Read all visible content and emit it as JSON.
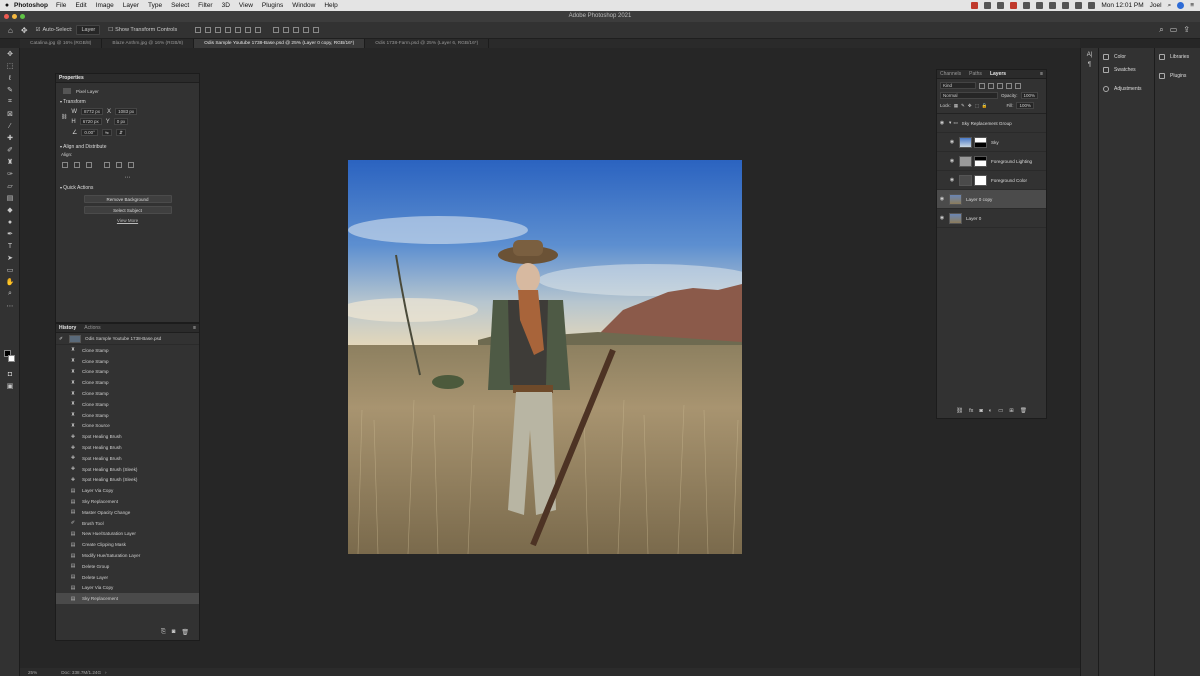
{
  "menubar": {
    "app": "Photoshop",
    "items": [
      "File",
      "Edit",
      "Image",
      "Layer",
      "Type",
      "Select",
      "Filter",
      "3D",
      "View",
      "Plugins",
      "Window",
      "Help"
    ],
    "clock": "Mon 12:01 PM",
    "user": "Joel"
  },
  "window": {
    "title": "Adobe Photoshop 2021"
  },
  "options": {
    "auto_select_label": "Auto-Select:",
    "auto_select_value": "Layer",
    "transform_controls": "Show Transform Controls"
  },
  "tabs": [
    "Catalina.jpg @ 16% (RGB/8)",
    "Blaze Anthm.jpg @ 16% (RGB/8)",
    "Odis Sample Youtube 1738-Base.psd @ 25% (Layer 0 copy, RGB/16*)",
    "Odis 1738-Farm.psd @ 25% (Layer 6, RGB/16*)"
  ],
  "properties": {
    "title": "Properties",
    "layer_type": "Pixel Layer",
    "transform_title": "Transform",
    "w": "8772 px",
    "x": "1083 px",
    "h": "6720 px",
    "y": "0 px",
    "angle": "0.00°",
    "align_title": "Align and Distribute",
    "align_label": "Align:",
    "quick_title": "Quick Actions",
    "remove_bg": "Remove Background",
    "select_subject": "Select Subject",
    "view_more": "View More"
  },
  "history": {
    "tab_history": "History",
    "tab_actions": "Actions",
    "snapshot": "Odis Sample Youtube 1738-Base.psd",
    "items": [
      "Clone Stamp",
      "Clone Stamp",
      "Clone Stamp",
      "Clone Stamp",
      "Clone Stamp",
      "Clone Stamp",
      "Clone Stamp",
      "Clone Source",
      "Spot Healing Brush",
      "Spot Healing Brush",
      "Spot Healing Brush",
      "Spot Healing Brush (Sleek)",
      "Spot Healing Brush (Sleek)",
      "Layer Via Copy",
      "Sky Replacement",
      "Master Opacity Change",
      "Brush Tool",
      "New Hue/Saturation Layer",
      "Create Clipping Mask",
      "Modify Hue/Saturation Layer",
      "Delete Group",
      "Delete Layer",
      "Layer Via Copy",
      "Sky Replacement"
    ]
  },
  "layers": {
    "tabs": [
      "Channels",
      "Paths",
      "Layers"
    ],
    "kind": "Kind",
    "blend": "Normal",
    "opacity_label": "Opacity:",
    "opacity": "100%",
    "lock_label": "Lock:",
    "fill_label": "Fill:",
    "fill": "100%",
    "rows": [
      {
        "name": "Sky Replacement Group"
      },
      {
        "name": "Sky"
      },
      {
        "name": "Foreground Lighting"
      },
      {
        "name": "Foreground Color"
      },
      {
        "name": "Layer 0 copy"
      },
      {
        "name": "Layer 0"
      }
    ]
  },
  "dock": {
    "left": [
      "Color",
      "Swatches",
      "Adjustments"
    ],
    "right": [
      "Libraries",
      "Plugins"
    ]
  },
  "status": {
    "zoom": "25%",
    "doc": "Doc: 338.7M/1.24G"
  }
}
